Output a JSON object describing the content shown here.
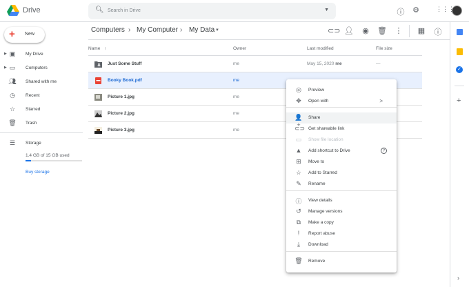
{
  "app": {
    "name": "Drive"
  },
  "search": {
    "placeholder": "Search in Drive"
  },
  "new_button": "New",
  "sidebar": {
    "items": [
      {
        "label": "My Drive",
        "icon": "my-drive-icon"
      },
      {
        "label": "Computers",
        "icon": "computers-icon"
      },
      {
        "label": "Shared with me",
        "icon": "shared-icon"
      },
      {
        "label": "Recent",
        "icon": "clock-icon"
      },
      {
        "label": "Starred",
        "icon": "star-icon"
      },
      {
        "label": "Trash",
        "icon": "trash-icon"
      }
    ],
    "storage": {
      "label": "Storage",
      "usage": "1.4 GB of 15 GB used",
      "fraction": 0.093,
      "buy": "Buy storage"
    }
  },
  "breadcrumb": [
    "Computers",
    "My Computer",
    "My Data"
  ],
  "columns": {
    "name": "Name",
    "owner": "Owner",
    "modified": "Last modified",
    "size": "File size"
  },
  "files": [
    {
      "name": "Just Some Stuff",
      "owner": "me",
      "modified": "May 15, 2020",
      "modified_by": "me",
      "size": "—",
      "type": "folder"
    },
    {
      "name": "Booky Book.pdf",
      "owner": "me",
      "modified": "",
      "size": "",
      "type": "pdf"
    },
    {
      "name": "Picture 1.jpg",
      "owner": "me",
      "type": "image"
    },
    {
      "name": "Picture 2.jpg",
      "owner": "me",
      "type": "image"
    },
    {
      "name": "Picture 3.jpg",
      "owner": "me",
      "type": "image"
    }
  ],
  "menu": [
    {
      "label": "Preview",
      "icon": "◎"
    },
    {
      "label": "Open with",
      "icon": "✥",
      "submenu": ">"
    },
    {
      "label": "Share",
      "icon": "👤+"
    },
    {
      "label": "Get shareable link",
      "icon": "⊂⊃"
    },
    {
      "label": "Show file location",
      "icon": "▭",
      "disabled": true
    },
    {
      "label": "Add shortcut to Drive",
      "icon": "▲",
      "help": "?"
    },
    {
      "label": "Move to",
      "icon": "⊞"
    },
    {
      "label": "Add to Starred",
      "icon": "☆"
    },
    {
      "label": "Rename",
      "icon": "✎"
    },
    {
      "label": "View details",
      "icon": "ⓘ"
    },
    {
      "label": "Manage versions",
      "icon": "↺"
    },
    {
      "label": "Make a copy",
      "icon": "⧉"
    },
    {
      "label": "Report abuse",
      "icon": "!"
    },
    {
      "label": "Download",
      "icon": "⤓"
    },
    {
      "label": "Remove",
      "icon": "🗑"
    }
  ],
  "colors": {
    "accent": "#1a73e8",
    "selected_row": "#e8f0fe"
  }
}
